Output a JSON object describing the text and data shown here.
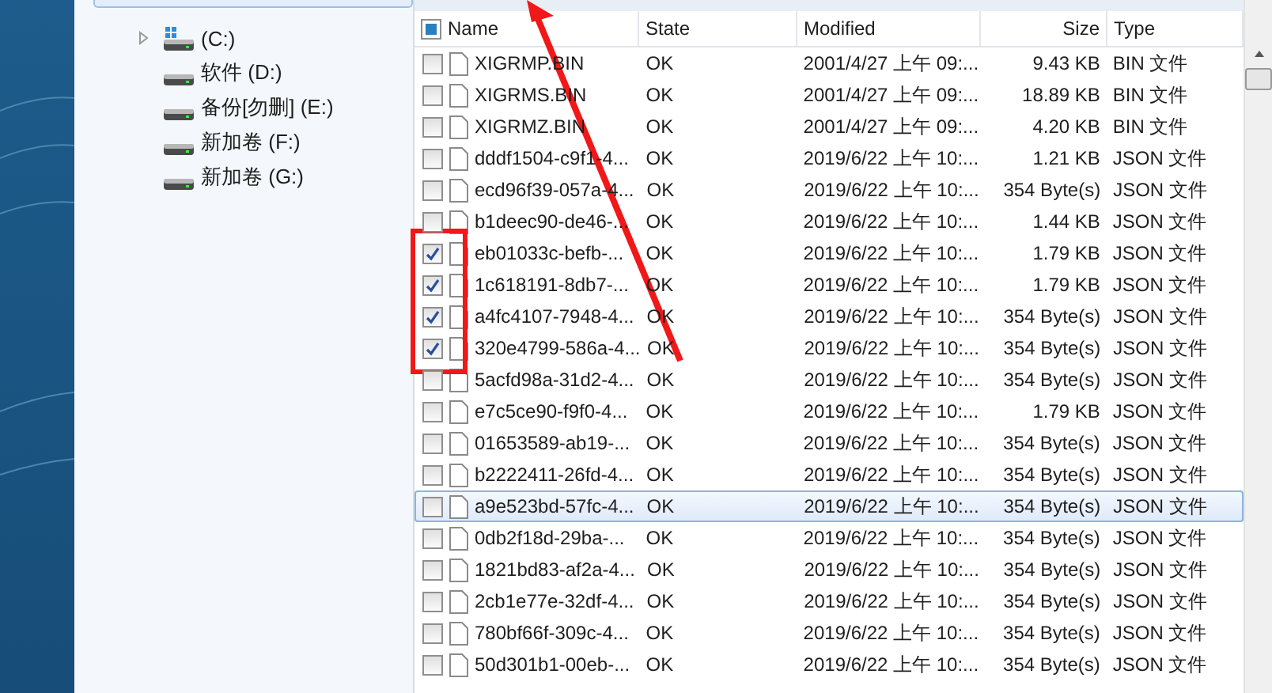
{
  "nav": {
    "items": [
      {
        "label": "(C:)",
        "kind": "system",
        "expandable": true
      },
      {
        "label": "软件 (D:)",
        "kind": "drive",
        "expandable": false
      },
      {
        "label": "备份[勿删] (E:)",
        "kind": "drive",
        "expandable": false
      },
      {
        "label": "新加卷 (F:)",
        "kind": "drive",
        "expandable": false
      },
      {
        "label": "新加卷 (G:)",
        "kind": "drive",
        "expandable": false
      }
    ]
  },
  "table": {
    "select_all": {
      "indeterminate": true
    },
    "columns": [
      {
        "label": "Name"
      },
      {
        "label": "State"
      },
      {
        "label": "Modified"
      },
      {
        "label": "Size"
      },
      {
        "label": "Type"
      }
    ],
    "rows": [
      {
        "name": "XIGRMP.BIN",
        "state": "OK",
        "modified": "2001/4/27 上午 09:...",
        "size": "9.43 KB",
        "type": "BIN 文件",
        "checked": false,
        "selected": false
      },
      {
        "name": "XIGRMS.BIN",
        "state": "OK",
        "modified": "2001/4/27 上午 09:...",
        "size": "18.89 KB",
        "type": "BIN 文件",
        "checked": false,
        "selected": false
      },
      {
        "name": "XIGRMZ.BIN",
        "state": "OK",
        "modified": "2001/4/27 上午 09:...",
        "size": "4.20 KB",
        "type": "BIN 文件",
        "checked": false,
        "selected": false
      },
      {
        "name": "dddf1504-c9f1-4...",
        "state": "OK",
        "modified": "2019/6/22 上午 10:...",
        "size": "1.21 KB",
        "type": "JSON 文件",
        "checked": false,
        "selected": false
      },
      {
        "name": "ecd96f39-057a-4...",
        "state": "OK",
        "modified": "2019/6/22 上午 10:...",
        "size": "354 Byte(s)",
        "type": "JSON 文件",
        "checked": false,
        "selected": false
      },
      {
        "name": "b1deec90-de46-...",
        "state": "OK",
        "modified": "2019/6/22 上午 10:...",
        "size": "1.44 KB",
        "type": "JSON 文件",
        "checked": false,
        "selected": false
      },
      {
        "name": "eb01033c-befb-...",
        "state": "OK",
        "modified": "2019/6/22 上午 10:...",
        "size": "1.79 KB",
        "type": "JSON 文件",
        "checked": true,
        "selected": false
      },
      {
        "name": "1c618191-8db7-...",
        "state": "OK",
        "modified": "2019/6/22 上午 10:...",
        "size": "1.79 KB",
        "type": "JSON 文件",
        "checked": true,
        "selected": false
      },
      {
        "name": "a4fc4107-7948-4...",
        "state": "OK",
        "modified": "2019/6/22 上午 10:...",
        "size": "354 Byte(s)",
        "type": "JSON 文件",
        "checked": true,
        "selected": false
      },
      {
        "name": "320e4799-586a-4...",
        "state": "OK",
        "modified": "2019/6/22 上午 10:...",
        "size": "354 Byte(s)",
        "type": "JSON 文件",
        "checked": true,
        "selected": false
      },
      {
        "name": "5acfd98a-31d2-4...",
        "state": "OK",
        "modified": "2019/6/22 上午 10:...",
        "size": "354 Byte(s)",
        "type": "JSON 文件",
        "checked": false,
        "selected": false
      },
      {
        "name": "e7c5ce90-f9f0-4...",
        "state": "OK",
        "modified": "2019/6/22 上午 10:...",
        "size": "1.79 KB",
        "type": "JSON 文件",
        "checked": false,
        "selected": false
      },
      {
        "name": "01653589-ab19-...",
        "state": "OK",
        "modified": "2019/6/22 上午 10:...",
        "size": "354 Byte(s)",
        "type": "JSON 文件",
        "checked": false,
        "selected": false
      },
      {
        "name": "b2222411-26fd-4...",
        "state": "OK",
        "modified": "2019/6/22 上午 10:...",
        "size": "354 Byte(s)",
        "type": "JSON 文件",
        "checked": false,
        "selected": false
      },
      {
        "name": "a9e523bd-57fc-4...",
        "state": "OK",
        "modified": "2019/6/22 上午 10:...",
        "size": "354 Byte(s)",
        "type": "JSON 文件",
        "checked": false,
        "selected": true
      },
      {
        "name": "0db2f18d-29ba-...",
        "state": "OK",
        "modified": "2019/6/22 上午 10:...",
        "size": "354 Byte(s)",
        "type": "JSON 文件",
        "checked": false,
        "selected": false
      },
      {
        "name": "1821bd83-af2a-4...",
        "state": "OK",
        "modified": "2019/6/22 上午 10:...",
        "size": "354 Byte(s)",
        "type": "JSON 文件",
        "checked": false,
        "selected": false
      },
      {
        "name": "2cb1e77e-32df-4...",
        "state": "OK",
        "modified": "2019/6/22 上午 10:...",
        "size": "354 Byte(s)",
        "type": "JSON 文件",
        "checked": false,
        "selected": false
      },
      {
        "name": "780bf66f-309c-4...",
        "state": "OK",
        "modified": "2019/6/22 上午 10:...",
        "size": "354 Byte(s)",
        "type": "JSON 文件",
        "checked": false,
        "selected": false
      },
      {
        "name": "50d301b1-00eb-...",
        "state": "OK",
        "modified": "2019/6/22 上午 10:...",
        "size": "354 Byte(s)",
        "type": "JSON 文件",
        "checked": false,
        "selected": false
      }
    ]
  }
}
